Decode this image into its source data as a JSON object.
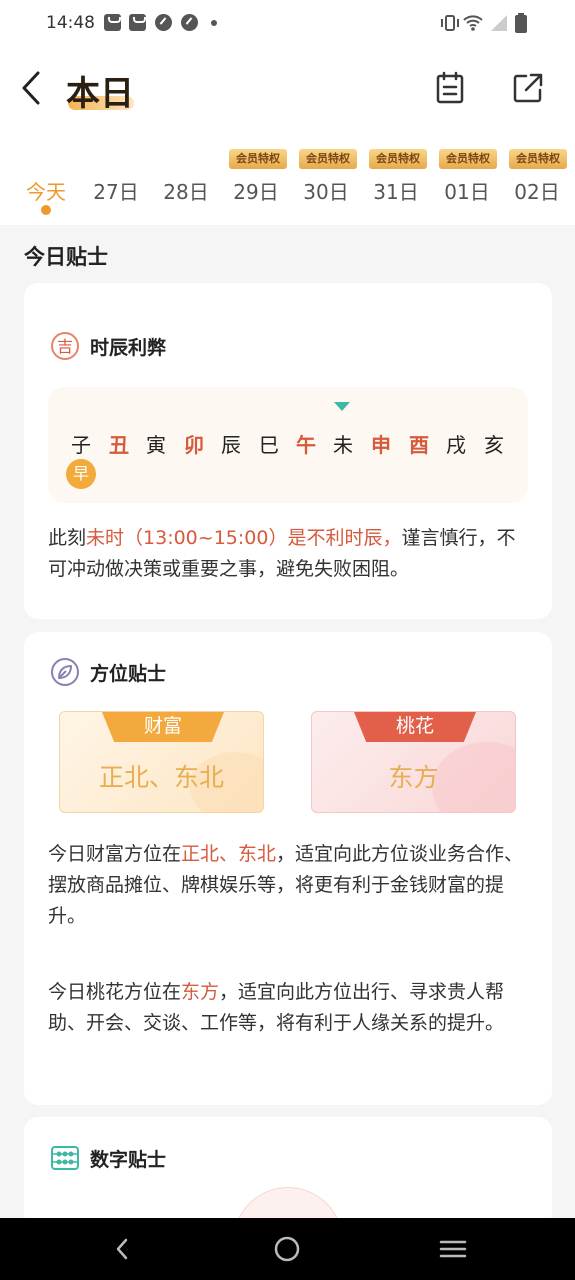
{
  "status_bar": {
    "time": "14:48"
  },
  "header": {
    "title": "本日"
  },
  "dates": [
    {
      "label": "今天",
      "vip": ""
    },
    {
      "label": "27日",
      "vip": ""
    },
    {
      "label": "28日",
      "vip": ""
    },
    {
      "label": "29日",
      "vip": "会员特权"
    },
    {
      "label": "30日",
      "vip": "会员特权"
    },
    {
      "label": "31日",
      "vip": "会员特权"
    },
    {
      "label": "01日",
      "vip": "会员特权"
    },
    {
      "label": "02日",
      "vip": "会员特权"
    }
  ],
  "section_title": "今日贴士",
  "hours_card": {
    "icon_char": "吉",
    "title": "时辰利弊",
    "hours": [
      "子",
      "丑",
      "寅",
      "卯",
      "辰",
      "巳",
      "午",
      "未",
      "申",
      "酉",
      "戌",
      "亥"
    ],
    "bad_hours": [
      1,
      3,
      6,
      8,
      9
    ],
    "badge": "早",
    "text_1": "此刻",
    "text_hl": "未时（13:00~15:00）是不利时辰，",
    "text_2": "谨言慎行，不可冲动做决策或重要之事，避免失败困阻。"
  },
  "direction_card": {
    "title": "方位贴士",
    "wealth_label": "财富",
    "wealth_value": "正北、东北",
    "peach_label": "桃花",
    "peach_value": "东方",
    "p1_a": "今日财富方位在",
    "p1_hl": "正北、东北",
    "p1_b": "，适宜向此方位谈业务合作、摆放商品摊位、牌棋娱乐等，将更有利于金钱财富的提升。",
    "p2_a": "今日桃花方位在",
    "p2_hl": "东方",
    "p2_b": "，适宜向此方位出行、寻求贵人帮助、开会、交谈、工作等，将有利于人缘关系的提升。"
  },
  "number_card": {
    "title": "数字贴士"
  },
  "colors": {
    "accent": "#ec9a2e",
    "bad_hour": "#d65a3c",
    "teal": "#3db8a1"
  }
}
